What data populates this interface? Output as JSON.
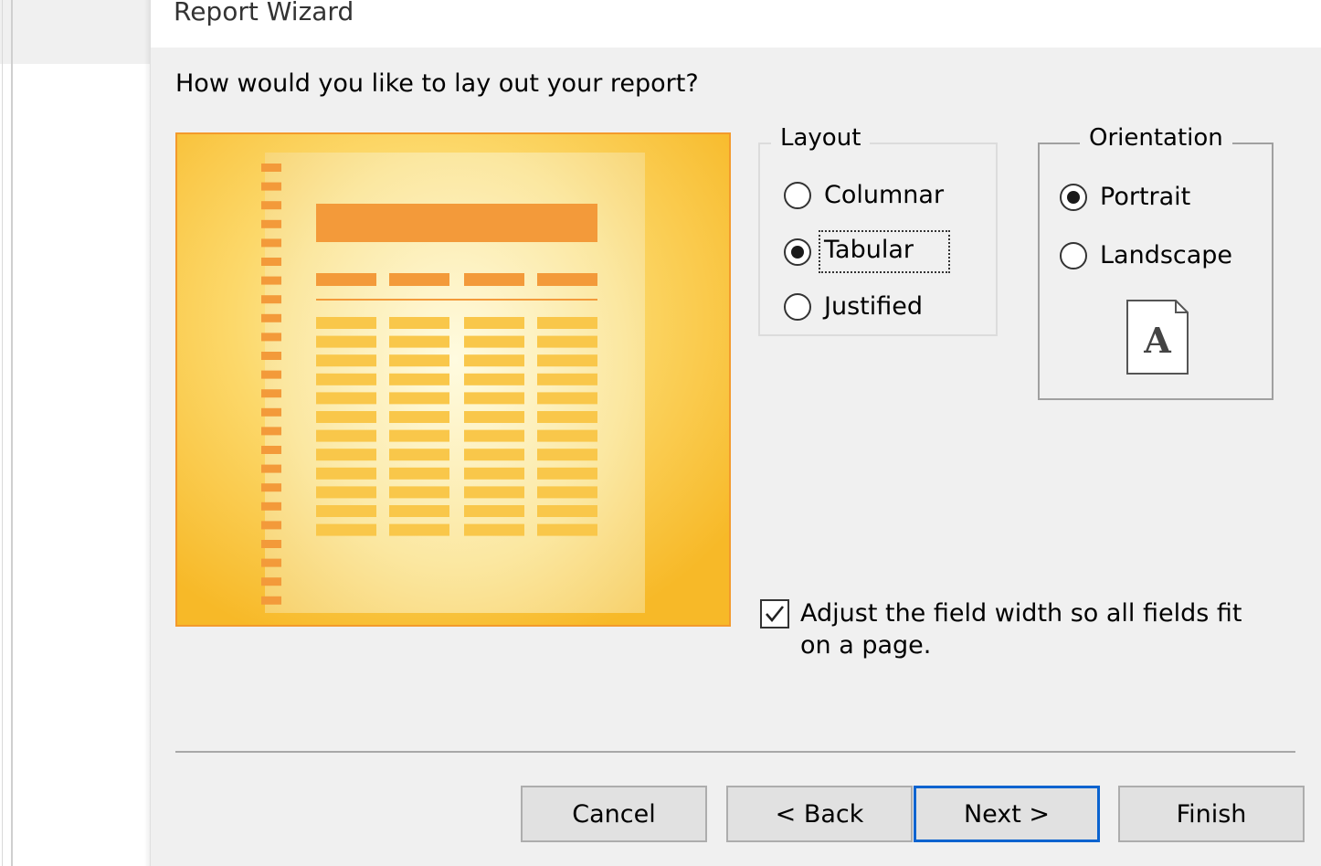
{
  "window": {
    "title": "Report Wizard"
  },
  "prompt": "How would you like to lay out your report?",
  "layout": {
    "legend": "Layout",
    "options": [
      "Columnar",
      "Tabular",
      "Justified"
    ],
    "selected": "Tabular"
  },
  "orientation": {
    "legend": "Orientation",
    "options": [
      "Portrait",
      "Landscape"
    ],
    "selected": "Portrait",
    "icon_letter": "A"
  },
  "adjust_width": {
    "label": "Adjust the field width so all fields fit on a page.",
    "checked": true
  },
  "buttons": {
    "cancel": "Cancel",
    "back": "< Back",
    "next": "Next >",
    "finish": "Finish"
  },
  "colors": {
    "preview_border": "#f39a2c",
    "preview_bg": "#f8bf2e",
    "bar": "#f39a3a",
    "default_button_border": "#0a63cf"
  }
}
